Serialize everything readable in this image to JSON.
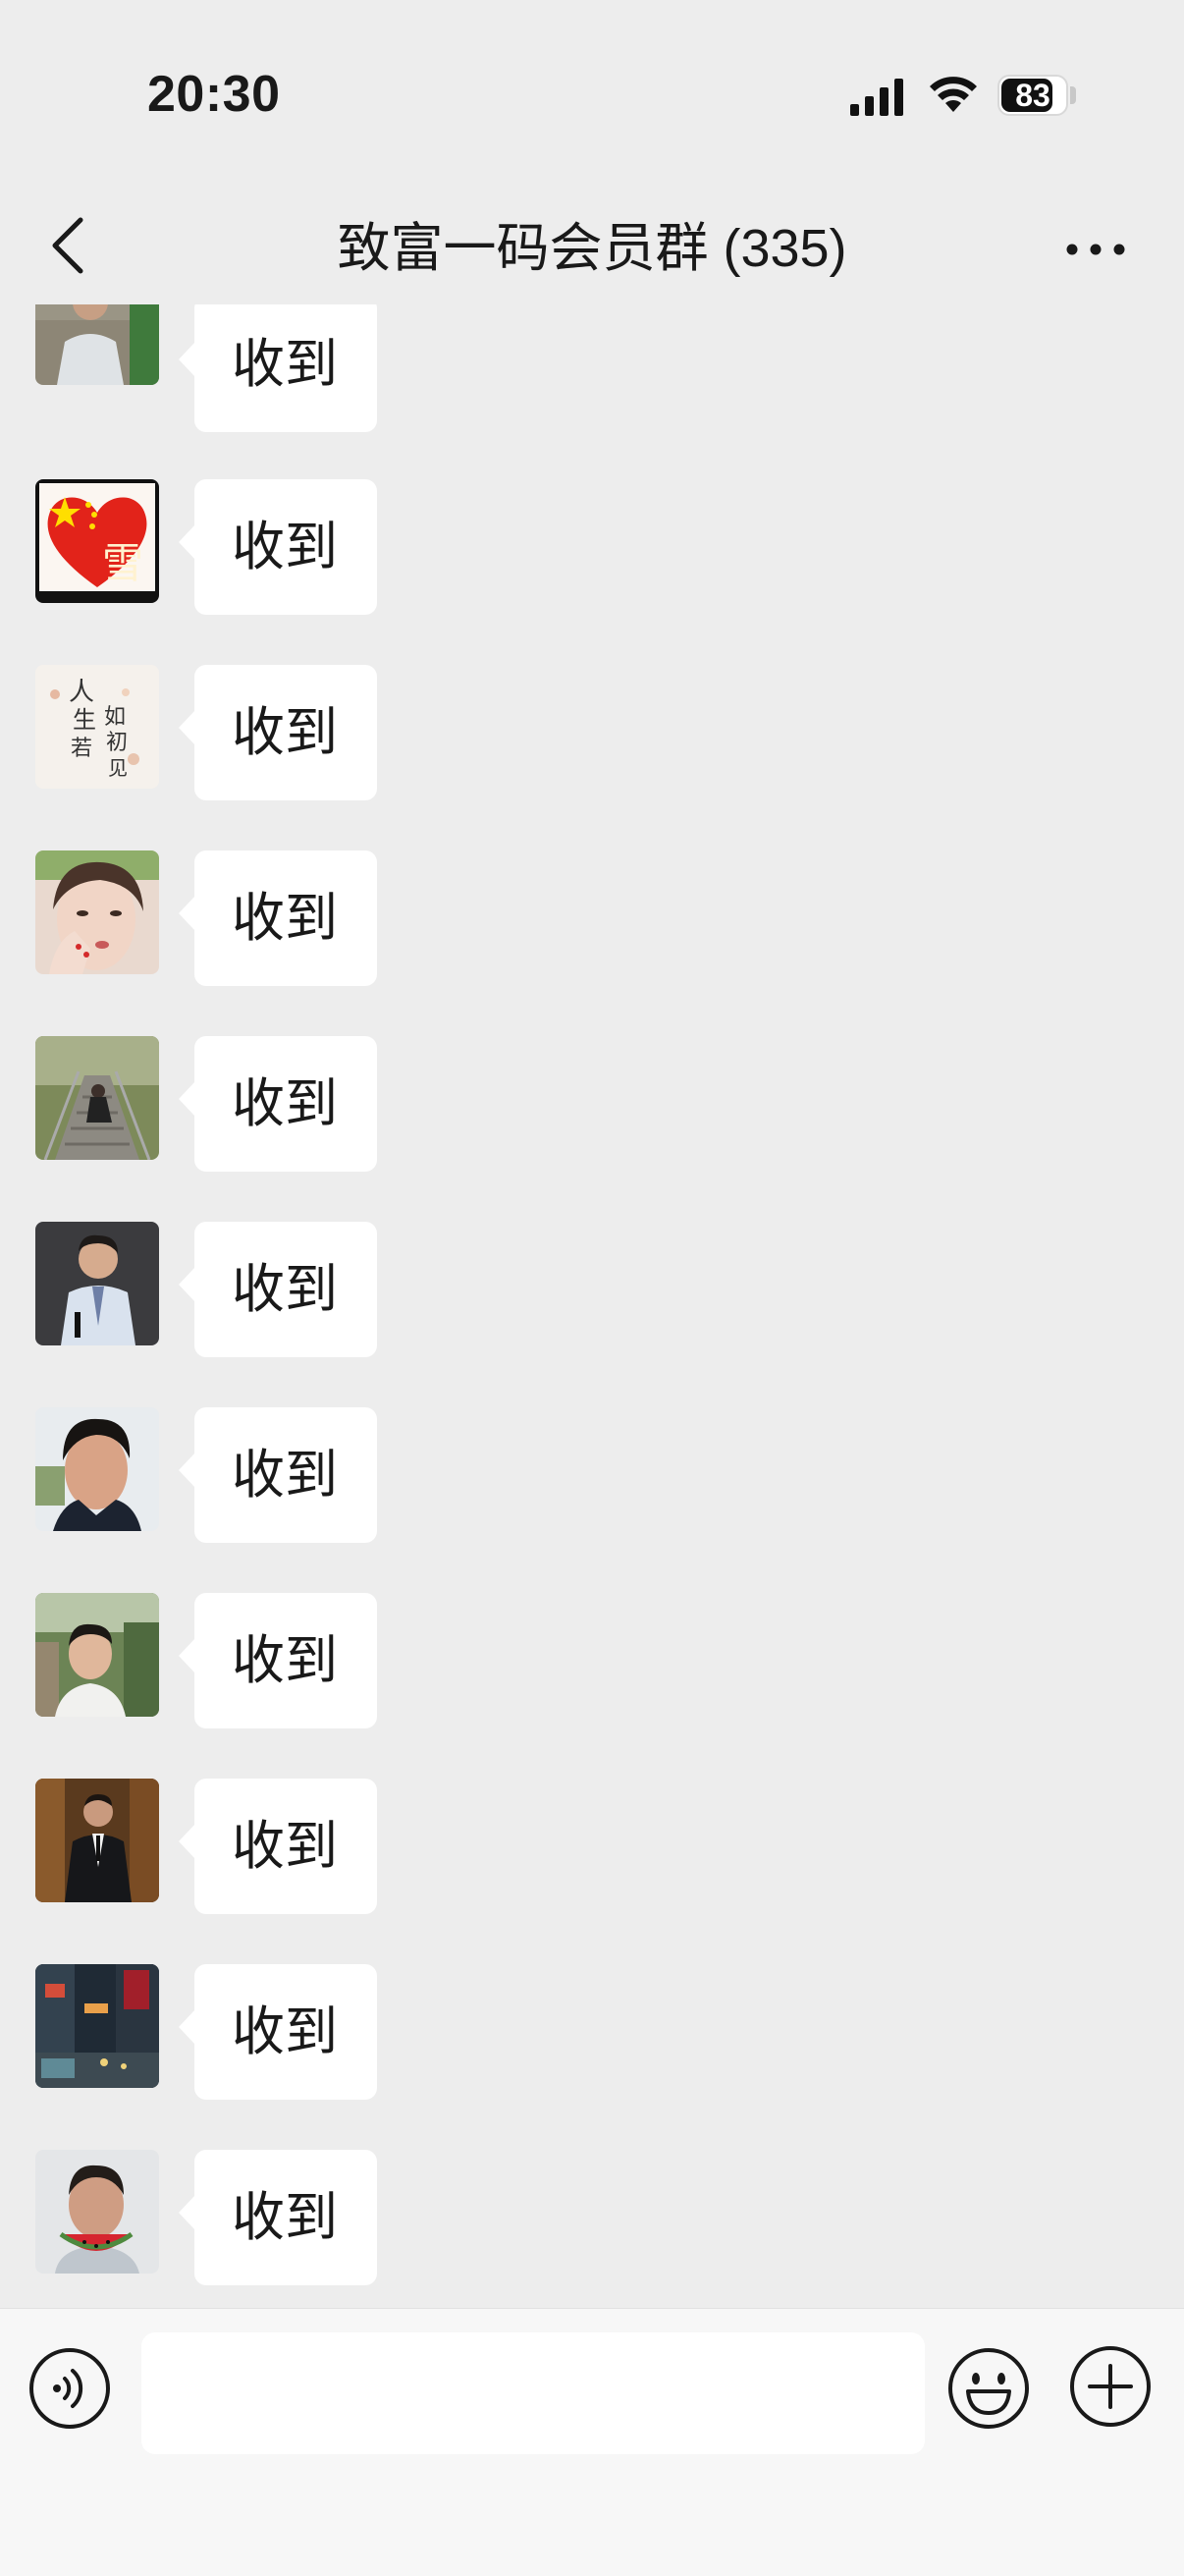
{
  "status_bar": {
    "time": "20:30",
    "battery_level": 83,
    "battery_text": "83"
  },
  "nav": {
    "title": "致富一码会员群 (335)",
    "back_icon": "chevron-left-icon",
    "more_icon": "ellipsis-icon"
  },
  "messages": [
    {
      "text": "收到",
      "avatar": "avatar-man-white-shirt"
    },
    {
      "text": "收到",
      "avatar": "avatar-heart-flag"
    },
    {
      "text": "收到",
      "avatar": "avatar-calligraphy"
    },
    {
      "text": "收到",
      "avatar": "avatar-girl"
    },
    {
      "text": "收到",
      "avatar": "avatar-man-stairs"
    },
    {
      "text": "收到",
      "avatar": "avatar-man-suit-gray"
    },
    {
      "text": "收到",
      "avatar": "avatar-young-man"
    },
    {
      "text": "收到",
      "avatar": "avatar-man-trees"
    },
    {
      "text": "收到",
      "avatar": "avatar-man-black-suit"
    },
    {
      "text": "收到",
      "avatar": "avatar-city-street"
    },
    {
      "text": "收到",
      "avatar": "avatar-man-watermelon"
    }
  ],
  "input_bar": {
    "voice_icon": "voice-icon",
    "input_value": "",
    "emoji_icon": "emoji-icon",
    "plus_icon": "plus-icon"
  },
  "colors": {
    "background": "#ededed",
    "bubble": "#ffffff",
    "input_bar": "#f7f7f7",
    "text": "#191919"
  }
}
